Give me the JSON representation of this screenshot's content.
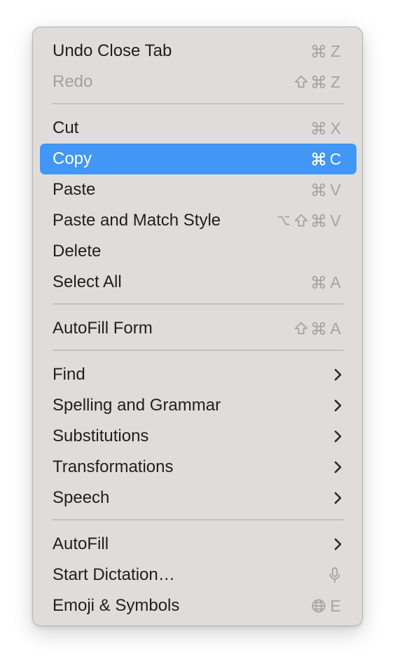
{
  "menu": {
    "items": [
      {
        "label": "Undo Close Tab",
        "shortcut_key": "Z",
        "modifiers": [
          "command"
        ],
        "state": "normal"
      },
      {
        "label": "Redo",
        "shortcut_key": "Z",
        "modifiers": [
          "shift",
          "command"
        ],
        "state": "disabled"
      },
      {
        "label": "Cut",
        "shortcut_key": "X",
        "modifiers": [
          "command"
        ],
        "state": "normal"
      },
      {
        "label": "Copy",
        "shortcut_key": "C",
        "modifiers": [
          "command"
        ],
        "state": "highlighted"
      },
      {
        "label": "Paste",
        "shortcut_key": "V",
        "modifiers": [
          "command"
        ],
        "state": "normal"
      },
      {
        "label": "Paste and Match Style",
        "shortcut_key": "V",
        "modifiers": [
          "option",
          "shift",
          "command"
        ],
        "state": "normal"
      },
      {
        "label": "Delete",
        "state": "normal"
      },
      {
        "label": "Select All",
        "shortcut_key": "A",
        "modifiers": [
          "command"
        ],
        "state": "normal"
      },
      {
        "label": "AutoFill Form",
        "shortcut_key": "A",
        "modifiers": [
          "shift",
          "command"
        ],
        "state": "normal"
      },
      {
        "label": "Find",
        "submenu": true
      },
      {
        "label": "Spelling and Grammar",
        "submenu": true
      },
      {
        "label": "Substitutions",
        "submenu": true
      },
      {
        "label": "Transformations",
        "submenu": true
      },
      {
        "label": "Speech",
        "submenu": true
      },
      {
        "label": "AutoFill",
        "submenu": true
      },
      {
        "label": "Start Dictation…",
        "shortcut_icon": "microphone-icon"
      },
      {
        "label": "Emoji & Symbols",
        "shortcut_key": "E",
        "modifiers": [
          "globe"
        ]
      }
    ]
  },
  "colors": {
    "menu_background": "#e0dcdb",
    "highlight": "#4196f6",
    "text": "#1f1f1f",
    "disabled_text": "#a3a09f",
    "shortcut_text": "#a6a3a2",
    "separator": "#c6c2c1"
  }
}
